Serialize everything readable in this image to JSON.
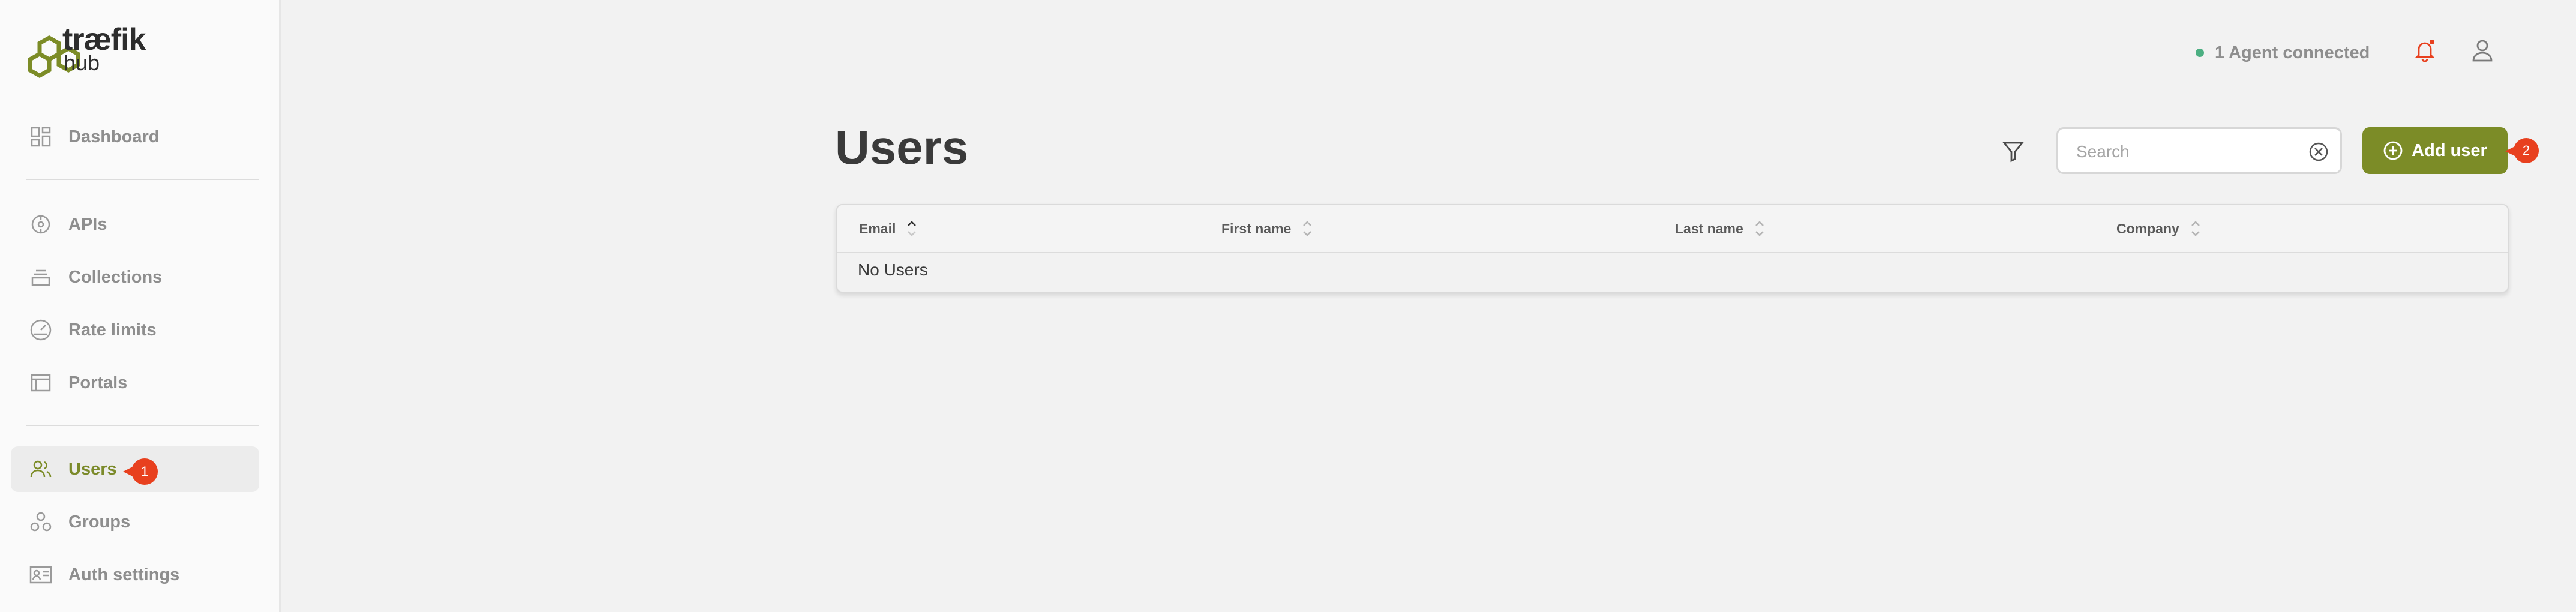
{
  "brand": {
    "word1": "træfik",
    "word2": "hub"
  },
  "sidebar": {
    "items": [
      {
        "label": "Dashboard",
        "icon": "dashboard-icon"
      },
      {
        "label": "APIs",
        "icon": "api-icon"
      },
      {
        "label": "Collections",
        "icon": "collections-icon"
      },
      {
        "label": "Rate limits",
        "icon": "gauge-icon"
      },
      {
        "label": "Portals",
        "icon": "portal-icon"
      },
      {
        "label": "Users",
        "icon": "users-icon",
        "active": true,
        "badge": "1"
      },
      {
        "label": "Groups",
        "icon": "groups-icon"
      },
      {
        "label": "Auth settings",
        "icon": "id-card-icon"
      }
    ]
  },
  "header": {
    "agent_status": "1 Agent connected",
    "status_color": "#4caf82"
  },
  "main": {
    "title": "Users",
    "search_placeholder": "Search",
    "add_button_label": "Add user",
    "add_badge": "2",
    "table": {
      "columns": [
        "Email",
        "First name",
        "Last name",
        "Company"
      ],
      "empty_text": "No Users"
    }
  },
  "colors": {
    "accent": "#7c8c27",
    "badge": "#e8401e",
    "notification": "#e8401e"
  }
}
